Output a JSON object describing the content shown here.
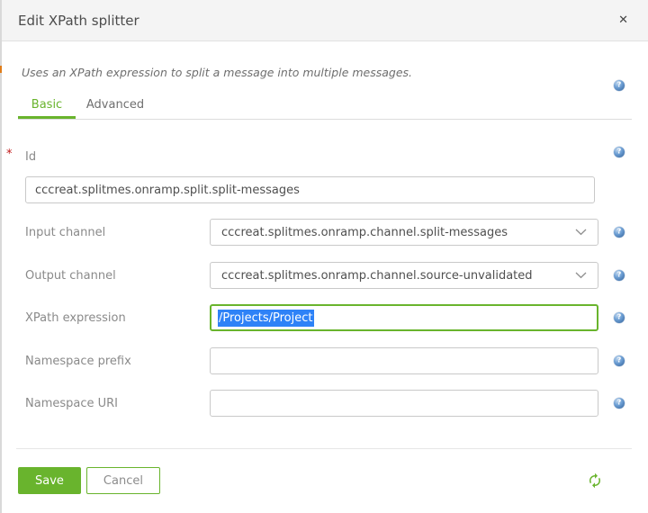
{
  "window": {
    "title": "Edit XPath splitter"
  },
  "icons": {
    "close": "✕",
    "help": "?"
  },
  "dialog": {
    "description": "Uses an XPath expression to split a message into multiple messages.",
    "tabs": {
      "basic": "Basic",
      "advanced": "Advanced"
    },
    "required_marker": "*",
    "fields": {
      "id": {
        "label": "Id",
        "value": "cccreat.splitmes.onramp.split.split-messages"
      },
      "input_channel": {
        "label": "Input channel",
        "value": "cccreat.splitmes.onramp.channel.split-messages"
      },
      "output_channel": {
        "label": "Output channel",
        "value": "cccreat.splitmes.onramp.channel.source-unvalidated"
      },
      "xpath_expression": {
        "label": "XPath expression",
        "value": "/Projects/Project"
      },
      "namespace_prefix": {
        "label": "Namespace prefix",
        "value": ""
      },
      "namespace_uri": {
        "label": "Namespace URI",
        "value": ""
      }
    },
    "footer": {
      "save": "Save",
      "cancel": "Cancel"
    },
    "colors": {
      "accent": "#69b42d",
      "selection_blue": "#2e82f7",
      "help_icon_blue": "#4a86c8"
    }
  }
}
